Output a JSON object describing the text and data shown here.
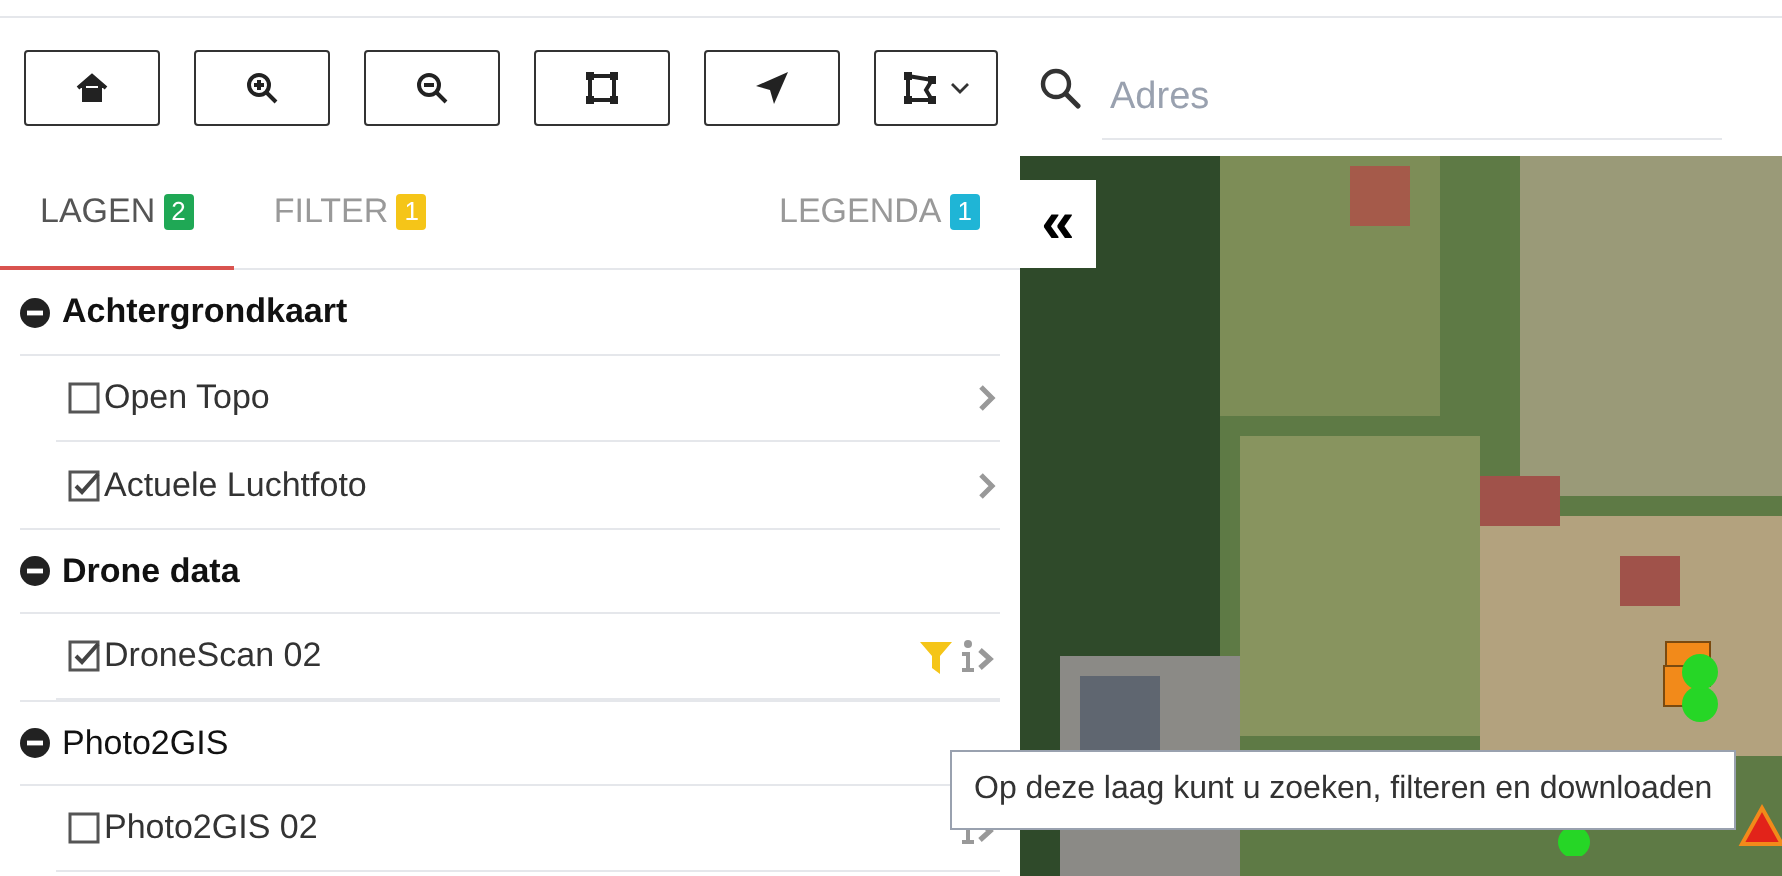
{
  "toolbar": {
    "buttons": [
      {
        "kind": "home"
      },
      {
        "kind": "zoom-in"
      },
      {
        "kind": "zoom-out"
      },
      {
        "kind": "extent"
      },
      {
        "kind": "locate"
      },
      {
        "kind": "draw"
      }
    ]
  },
  "search": {
    "placeholder": "Adres"
  },
  "tabs": [
    {
      "label": "LAGEN",
      "badge": "2",
      "color": "#1fa855",
      "selected": true
    },
    {
      "label": "FILTER",
      "badge": "1",
      "color": "#f5c518",
      "selected": false
    },
    {
      "label": "LEGENDA",
      "badge": "1",
      "color": "#1fb5d6",
      "selected": false
    }
  ],
  "collapse_button": {
    "label": "«"
  },
  "layer_groups": [
    {
      "title": "Achtergrondkaart",
      "expanded": true,
      "highlighted": true,
      "children": [
        {
          "label": "Open Topo",
          "checked": false,
          "filtered": false,
          "kind": "chevron"
        },
        {
          "label": "Actuele Luchtfoto",
          "checked": true,
          "filtered": false,
          "kind": "chevron"
        }
      ]
    },
    {
      "title": "Drone data",
      "expanded": true,
      "highlighted": true,
      "children": [
        {
          "label": "DroneScan 02",
          "checked": true,
          "filtered": true,
          "kind": "info"
        }
      ]
    },
    {
      "title": "Photo2GIS",
      "expanded": true,
      "highlighted": false,
      "children": [
        {
          "label": "Photo2GIS 02",
          "checked": false,
          "filtered": false,
          "kind": "info"
        }
      ]
    }
  ],
  "tooltip": {
    "text": "Op deze laag kunt u zoeken, filteren en downloaden"
  }
}
